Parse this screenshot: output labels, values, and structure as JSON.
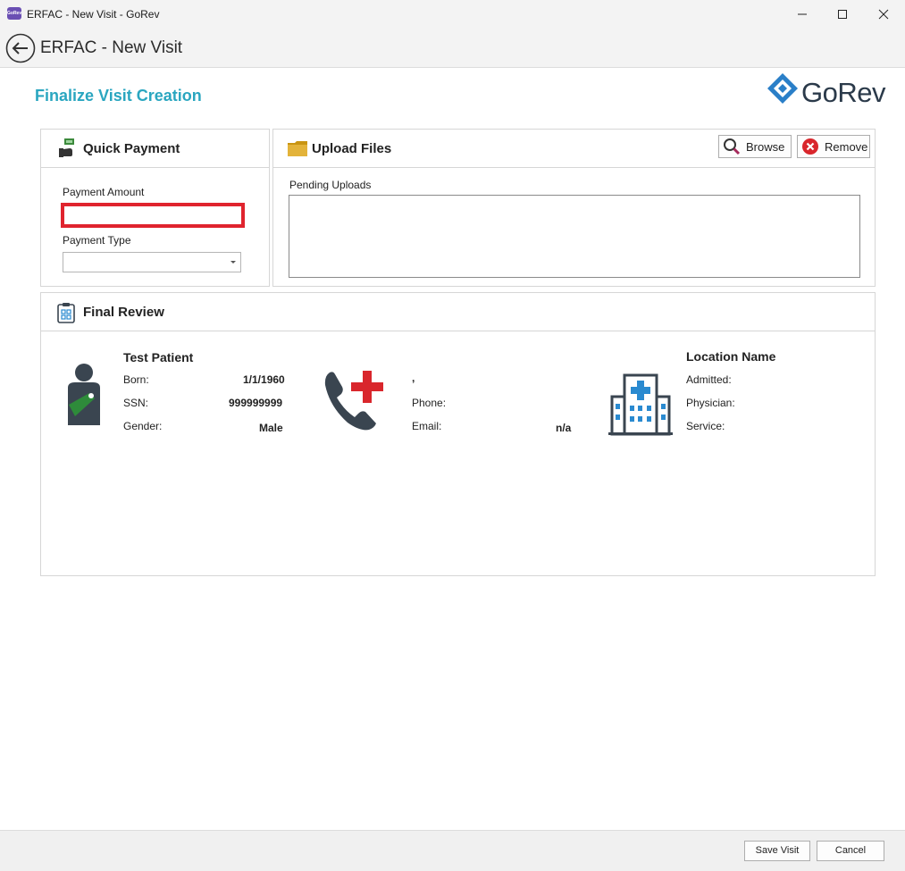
{
  "window": {
    "title": "ERFAC - New Visit - GoRev",
    "app_icon_text": "GoRev"
  },
  "header": {
    "title": "ERFAC - New Visit"
  },
  "page": {
    "title": "Finalize Visit Creation",
    "logo_text": "GoRev"
  },
  "quick_payment": {
    "title": "Quick Payment",
    "amount_label": "Payment Amount",
    "amount_value": "",
    "type_label": "Payment Type",
    "type_value": ""
  },
  "upload_files": {
    "title": "Upload Files",
    "browse_label": "Browse",
    "remove_label": "Remove",
    "pending_label": "Pending Uploads"
  },
  "final_review": {
    "title": "Final Review",
    "patient": {
      "name": "Test Patient",
      "born_label": "Born:",
      "born_value": "1/1/1960",
      "ssn_label": "SSN:",
      "ssn_value": "999999999",
      "gender_label": "Gender:",
      "gender_value": "Male"
    },
    "contact": {
      "name": ",",
      "phone_label": "Phone:",
      "phone_value": "",
      "email_label": "Email:",
      "email_value": "n/a"
    },
    "location": {
      "name": "Location Name",
      "admitted_label": "Admitted:",
      "physician_label": "Physician:",
      "service_label": "Service:"
    }
  },
  "footer": {
    "save_label": "Save Visit",
    "cancel_label": "Cancel"
  },
  "colors": {
    "accent": "#2aa6c0",
    "highlight_border": "#e0242e",
    "medical_red": "#d9262c",
    "sling_green": "#2e8b3a",
    "icon_dark": "#3a4550",
    "hospital_blue": "#2a8ad0",
    "folder_gold": "#d9a520"
  }
}
